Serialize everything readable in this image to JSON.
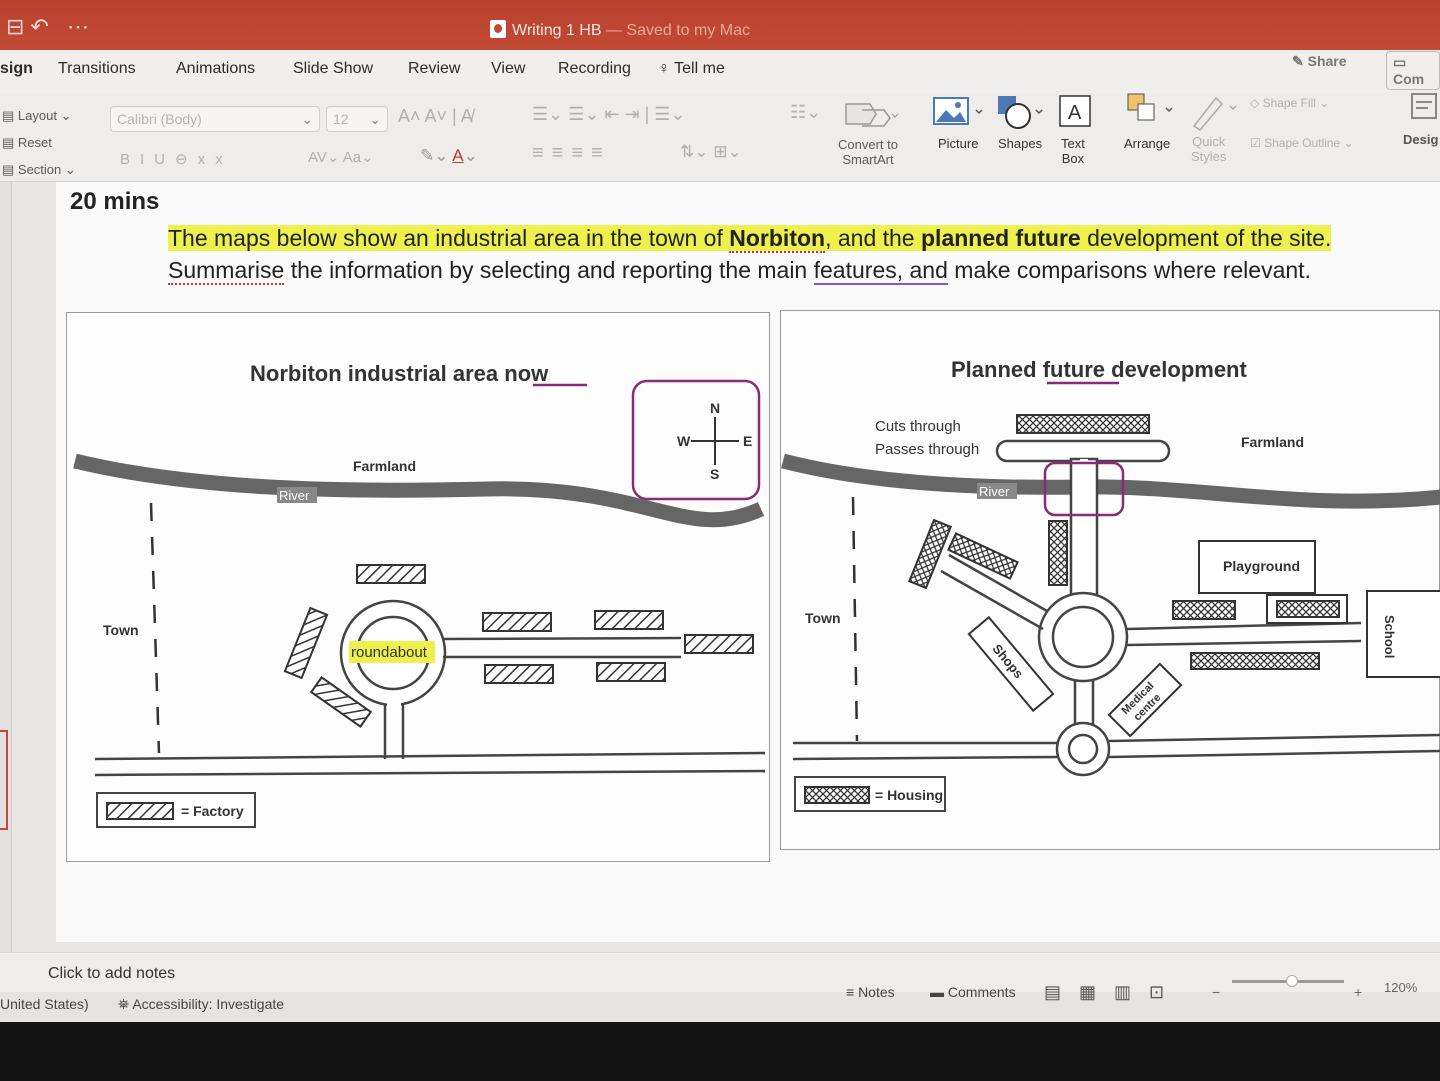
{
  "window": {
    "doc_title": "Writing 1 HB",
    "doc_status": "— Saved to my Mac"
  },
  "menu": {
    "tabs": [
      "sign",
      "Transitions",
      "Animations",
      "Slide Show",
      "Review",
      "View",
      "Recording"
    ],
    "tell_me": "Tell me",
    "share": "Share",
    "comments": "Com"
  },
  "ribbon": {
    "layout": "Layout",
    "reset": "Reset",
    "section": "Section",
    "font_name": "Calibri (Body)",
    "font_size": "12",
    "convert_smartart": [
      "Convert to",
      "SmartArt"
    ],
    "picture": "Picture",
    "shapes": "Shapes",
    "text_box": [
      "Text",
      "Box"
    ],
    "arrange": "Arrange",
    "quick_styles": [
      "Quick",
      "Styles"
    ],
    "shape_fill": "Shape Fill",
    "shape_outline": "Shape Outline",
    "design": "Desig"
  },
  "slide": {
    "time_label": "20 mins",
    "prompt": {
      "line1_a": "The maps below show an industrial area in the town of ",
      "line1_b": "Norbiton",
      "line1_c": ", and the ",
      "line1_d": "planned future",
      "line1_e": " development of the site.",
      "line2_a": "Summarise",
      "line2_b": " the information by selecting and reporting the main ",
      "line2_c": "features, and",
      "line2_d": " make comparisons where relevant."
    },
    "map_now": {
      "title_a": "Norbiton industrial area ",
      "title_b": "now",
      "farmland": "Farmland",
      "river": "River",
      "town": "Town",
      "roundabout": "roundabout",
      "compass": {
        "n": "N",
        "s": "S",
        "e": "E",
        "w": "W"
      },
      "legend": "= Factory"
    },
    "map_future": {
      "title_a": "Planned ",
      "title_b": "future",
      "title_c": " development",
      "note1": "Cuts through",
      "note2": "Passes through",
      "farmland": "Farmland",
      "river": "River",
      "town": "Town",
      "playground": "Playground",
      "shops": "Shops",
      "medical": [
        "Medical",
        "centre"
      ],
      "school": "School",
      "legend": "= Housing"
    }
  },
  "notes": {
    "placeholder": "Click to add notes"
  },
  "status": {
    "language": "United States)",
    "accessibility": "Accessibility: Investigate",
    "notes_btn": "Notes",
    "comments_btn": "Comments",
    "zoom": "120%"
  },
  "colors": {
    "accent": "#c24a34",
    "highlight": "#eef04d",
    "annotation": "#8a2a7a"
  }
}
